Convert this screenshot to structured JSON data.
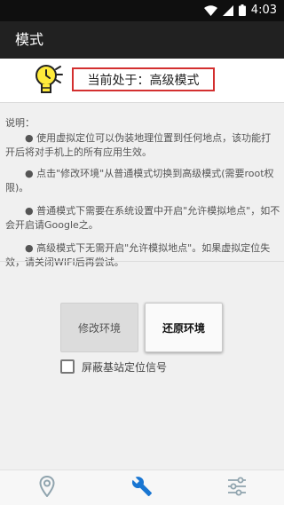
{
  "status_bar": {
    "time": "4:03",
    "icons": [
      "wifi-icon",
      "signal-icon",
      "battery-icon"
    ]
  },
  "app_bar": {
    "title": "模式"
  },
  "header": {
    "mode_text": "当前处于：高级模式",
    "icon": "lightbulb-icon"
  },
  "description": {
    "title": "说明：",
    "items": [
      "● 使用虚拟定位可以伪装地理位置到任何地点，该功能打开后将对手机上的所有应用生效。",
      "● 点击\"修改环境\"从普通模式切换到高级模式(需要root权限)。",
      "● 普通模式下需要在系统设置中开启\"允许模拟地点\"，如不会开启请Google之。",
      "● 高级模式下无需开启\"允许模拟地点\"。如果虚拟定位失效，请关闭WIFI后再尝试。"
    ]
  },
  "buttons": {
    "modify_label": "修改环境",
    "restore_label": "还原环境"
  },
  "checkbox": {
    "label": "屏蔽基站定位信号",
    "checked": false
  },
  "bottom_nav": {
    "items": [
      "location-pin-icon",
      "wrench-icon",
      "sliders-icon"
    ],
    "active_index": 1
  },
  "colors": {
    "app_bar": "#212121",
    "accent": "#1976d2",
    "highlight_border": "#d32f2f",
    "inactive_icon": "#90a4ae",
    "bulb": "#ffeb3b"
  }
}
